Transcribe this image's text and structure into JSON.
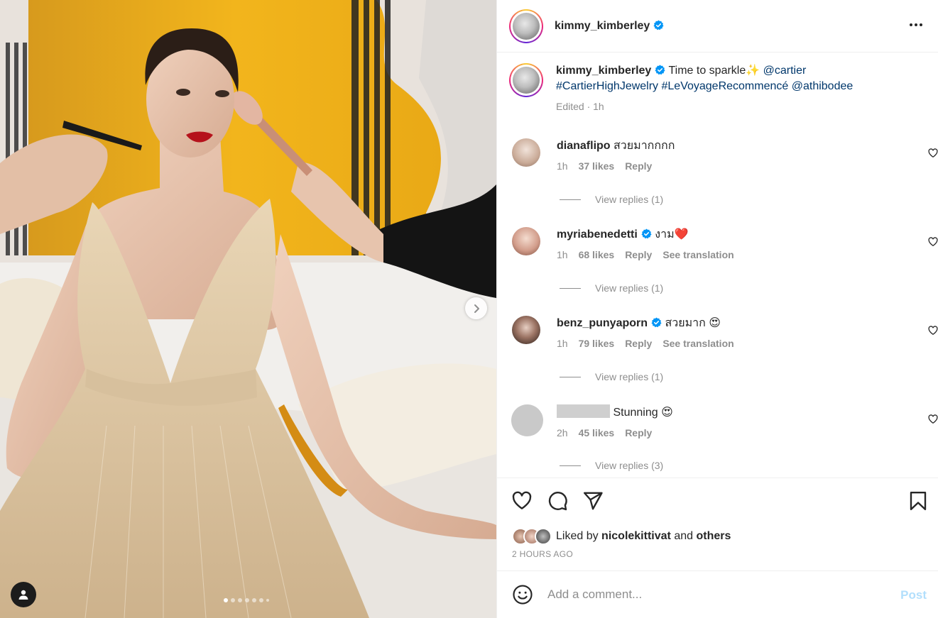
{
  "post": {
    "username": "kimmy_kimberley",
    "caption": {
      "text": "Time to sparkle✨",
      "mention_1": "@cartier",
      "hashtag_1": "#CartierHighJewelry",
      "hashtag_2": "#LeVoyageRecommencé",
      "mention_2": "@athibodee",
      "meta": "Edited · 1h"
    }
  },
  "comments": [
    {
      "username": "dianaflipo",
      "verified": false,
      "text": "สวยมากกกก",
      "time": "1h",
      "likes": "37 likes",
      "reply": "Reply",
      "see_translation": "",
      "view_replies": "View replies (1)"
    },
    {
      "username": "myriabenedetti",
      "verified": true,
      "text": "งาม❤️",
      "time": "1h",
      "likes": "68 likes",
      "reply": "Reply",
      "see_translation": "See translation",
      "view_replies": "View replies (1)"
    },
    {
      "username": "benz_punyaporn",
      "verified": true,
      "text": "สวยมาก 😍",
      "time": "1h",
      "likes": "79 likes",
      "reply": "Reply",
      "see_translation": "See translation",
      "view_replies": "View replies (1)"
    },
    {
      "username": "",
      "verified": false,
      "text": "Stunning 😍",
      "time": "2h",
      "likes": "45 likes",
      "reply": "Reply",
      "see_translation": "",
      "view_replies": "View replies (3)"
    }
  ],
  "likes": {
    "prefix": "Liked by",
    "user": "nicolekittivat",
    "joiner": "and",
    "others": "others"
  },
  "time_ago": "2 HOURS AGO",
  "add_comment": {
    "placeholder": "Add a comment...",
    "post_label": "Post"
  },
  "carousel": {
    "current_slide": 1,
    "total_slides": 7
  },
  "icons": {
    "more": "more-horizontal-icon",
    "like": "heart-icon",
    "comment": "comment-bubble-icon",
    "share": "paper-plane-icon",
    "save": "bookmark-icon",
    "emoji": "emoji-smile-icon",
    "next": "chevron-right-icon",
    "tag": "user-tag-icon",
    "verified": "verified-badge-icon"
  },
  "colors": {
    "link": "#00376b",
    "verified": "#0095f6",
    "post_disabled": "#b2dffc",
    "secondary_text": "#8e8e8e"
  }
}
